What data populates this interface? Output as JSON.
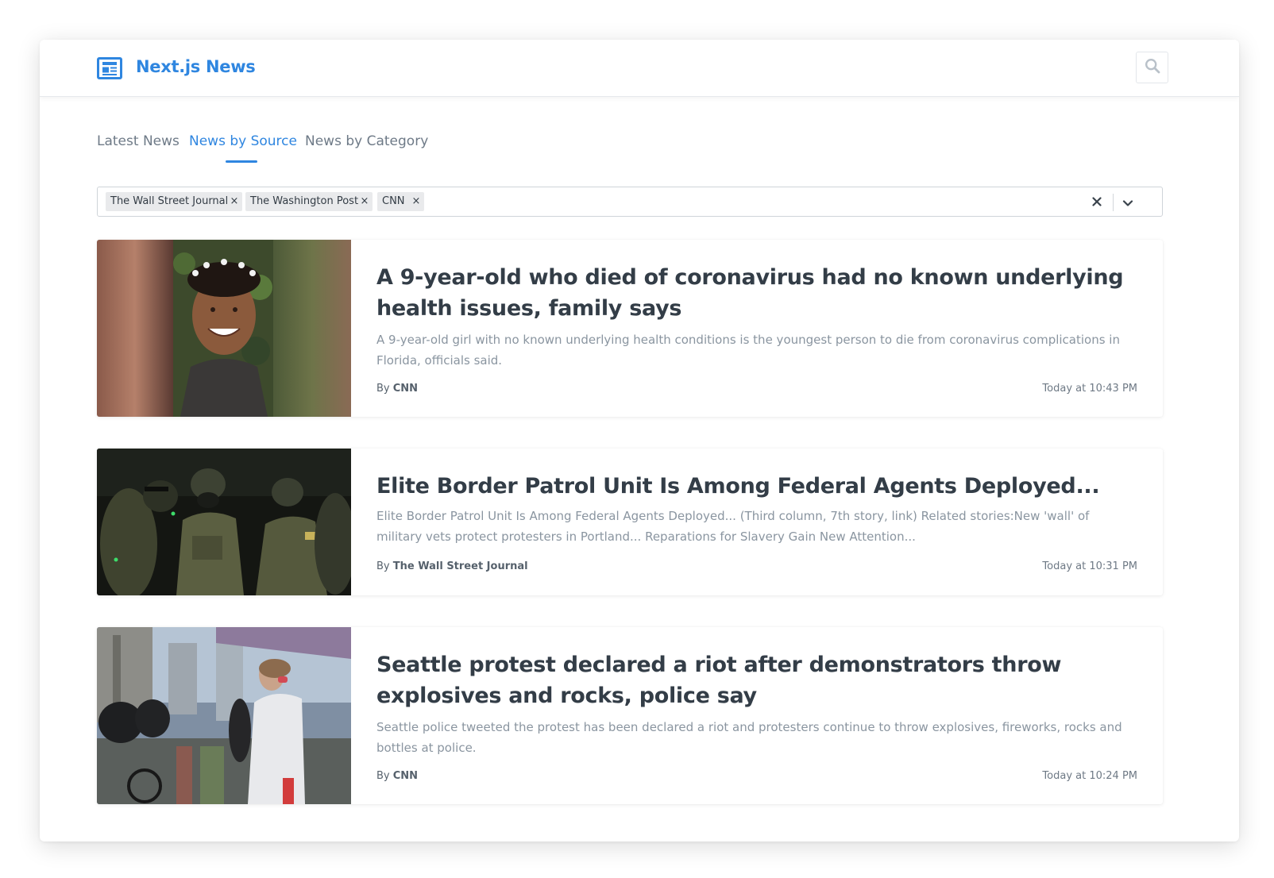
{
  "header": {
    "brand": "Next.js News",
    "logo_icon": "newspaper-icon",
    "search_icon": "search-icon",
    "accent_color": "#2f86e0"
  },
  "tabs": [
    {
      "label": "Latest News",
      "active": false
    },
    {
      "label": "News by Source",
      "active": true
    },
    {
      "label": "News by Category",
      "active": false
    }
  ],
  "source_filter": {
    "selected": [
      {
        "label": "The Wall Street Journal",
        "remove_symbol": "×"
      },
      {
        "label": "The Washington Post",
        "remove_symbol": "×"
      },
      {
        "label": "CNN",
        "remove_symbol": "×"
      }
    ],
    "clear_icon": "close-icon",
    "toggle_icon": "chevron-down-icon"
  },
  "articles": [
    {
      "title": "A 9-year-old who died of coronavirus had no known underlying health issues, family says",
      "description": "A 9-year-old girl with no known underlying health conditions is the youngest person to die from coronavirus complications in Florida, officials said.",
      "by_prefix": "By",
      "source": "CNN",
      "time": "Today at 10:43 PM"
    },
    {
      "title": "Elite Border Patrol Unit Is Among Federal Agents Deployed...",
      "description": "Elite Border Patrol Unit Is Among Federal Agents Deployed... (Third column, 7th story, link) Related stories:New 'wall' of military vets protect protesters in Portland... Reparations for Slavery Gain New Attention...",
      "by_prefix": "By",
      "source": "The Wall Street Journal",
      "time": "Today at 10:31 PM"
    },
    {
      "title": "Seattle protest declared a riot after demonstrators throw explosives and rocks, police say",
      "description": "Seattle police tweeted the protest has been declared a riot and protesters continue to throw explosives, fireworks, rocks and bottles at police.",
      "by_prefix": "By",
      "source": "CNN",
      "time": "Today at 10:24 PM"
    }
  ]
}
